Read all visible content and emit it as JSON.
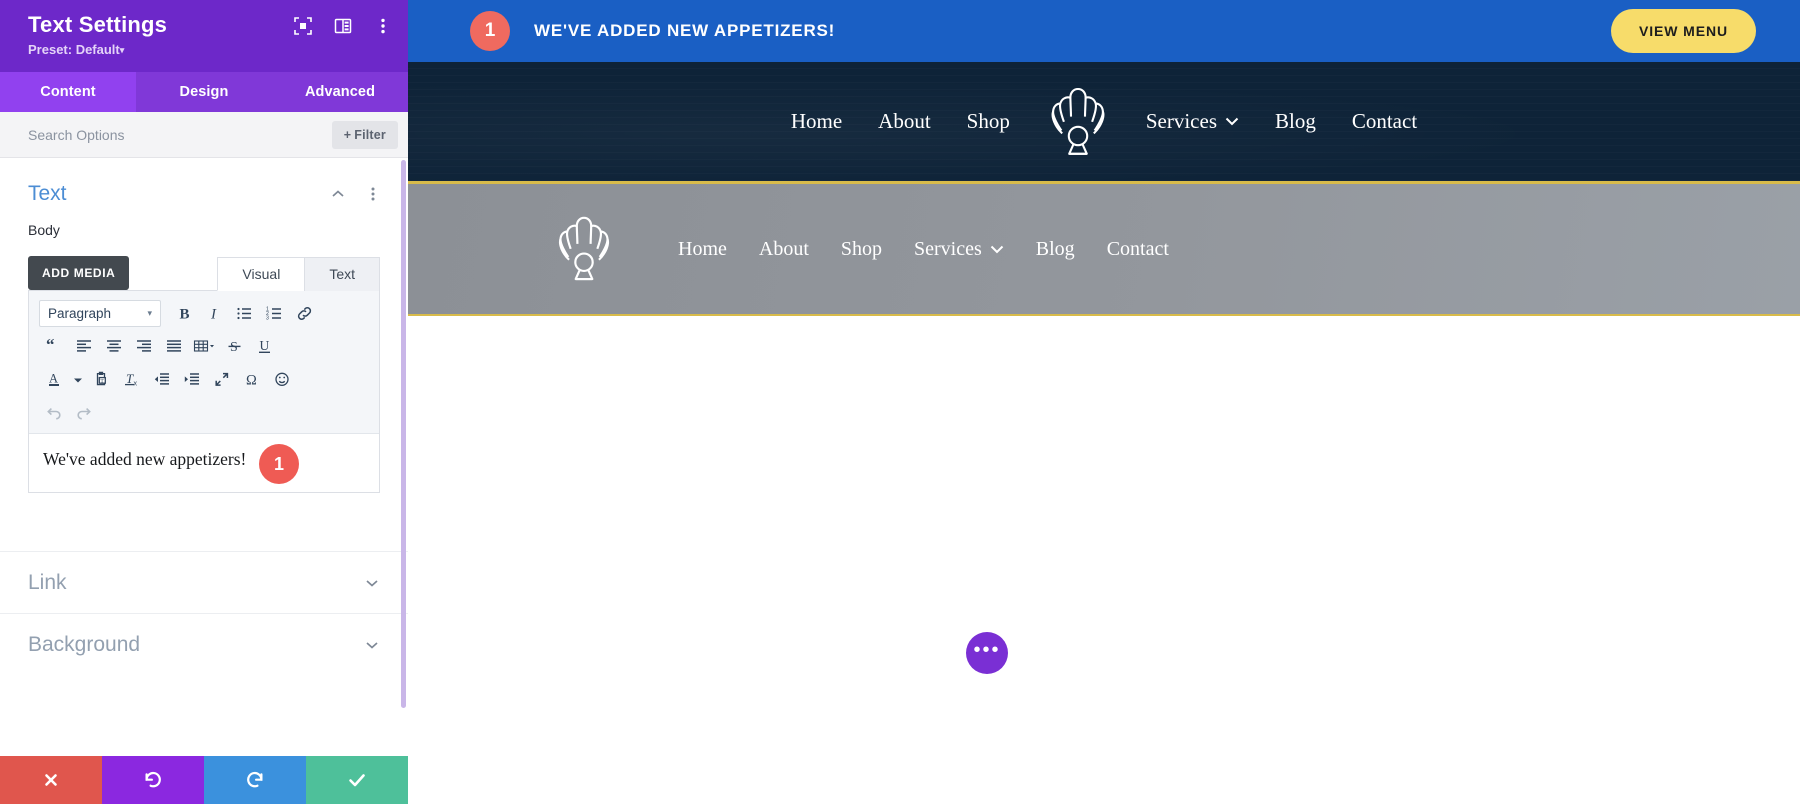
{
  "panel": {
    "title": "Text Settings",
    "preset": "Preset: Default",
    "preset_caret": "▾",
    "header_icons": [
      {
        "name": "focus-frame-icon",
        "label": "Focus"
      },
      {
        "name": "layout-columns-icon",
        "label": "Layout"
      },
      {
        "name": "kebab-menu-icon",
        "label": "More options"
      }
    ],
    "tabs": [
      {
        "label": "Content",
        "active": true
      },
      {
        "label": "Design",
        "active": false
      },
      {
        "label": "Advanced",
        "active": false
      }
    ],
    "search": {
      "placeholder": "Search Options",
      "value": "",
      "filter_label": "Filter",
      "filter_plus": "+"
    },
    "text_section": {
      "title": "Text",
      "body_label": "Body",
      "add_media_label": "ADD MEDIA",
      "editor_tabs": [
        {
          "label": "Visual",
          "active": true
        },
        {
          "label": "Text",
          "active": false
        }
      ],
      "format_select": {
        "value": "Paragraph",
        "caret": "▾"
      },
      "toolbar_row1": [
        "bold-icon",
        "italic-icon",
        "bulleted-list-icon",
        "numbered-list-icon",
        "link-icon"
      ],
      "toolbar_row2": [
        "blockquote-icon",
        "align-left-icon",
        "align-center-icon",
        "align-right-icon",
        "align-justify-icon",
        "table-icon",
        "strikethrough-icon",
        "underline-icon"
      ],
      "toolbar_row3": [
        "text-color-icon",
        "text-color-dropdown-icon",
        "paste-as-text-icon",
        "clear-formatting-icon",
        "outdent-icon",
        "indent-icon",
        "fullscreen-icon",
        "special-character-icon",
        "emoji-icon"
      ],
      "toolbar_row4": [
        "undo-icon",
        "redo-icon"
      ],
      "content_text": "We've added new appetizers!",
      "badge_number": "1"
    },
    "collapsed_sections": [
      {
        "label": "Link"
      },
      {
        "label": "Background"
      }
    ],
    "footer_actions": [
      {
        "name": "cancel",
        "icon": "close-icon",
        "color": "#e0564d"
      },
      {
        "name": "undo",
        "icon": "undo-icon",
        "color": "#8b28e0"
      },
      {
        "name": "redo",
        "icon": "redo-icon",
        "color": "#3b91dd"
      },
      {
        "name": "save",
        "icon": "check-icon",
        "color": "#4ec09a"
      }
    ]
  },
  "preview": {
    "promo": {
      "badge": "1",
      "text": "WE'VE ADDED NEW APPETIZERS!",
      "button_label": "VIEW MENU",
      "bg_color": "#1a5fc4",
      "badge_color": "#ef6a5f",
      "button_color": "#f7dc6a"
    },
    "nav_dark": {
      "bg_color": "#0e2338",
      "accent_color": "#d8bb4a",
      "logo": "scallop-shell-logo",
      "links_left": [
        {
          "label": "Home"
        },
        {
          "label": "About"
        },
        {
          "label": "Shop"
        }
      ],
      "links_right": [
        {
          "label": "Services",
          "caret": "⌄"
        },
        {
          "label": "Blog"
        },
        {
          "label": "Contact"
        }
      ]
    },
    "nav_grey": {
      "logo": "scallop-shell-logo",
      "links": [
        {
          "label": "Home"
        },
        {
          "label": "About"
        },
        {
          "label": "Shop"
        },
        {
          "label": "Services",
          "caret": "⌄"
        },
        {
          "label": "Blog"
        },
        {
          "label": "Contact"
        }
      ]
    },
    "fab": {
      "icon": "ellipsis-icon",
      "glyph": "•••",
      "color": "#7a2fd4"
    }
  }
}
